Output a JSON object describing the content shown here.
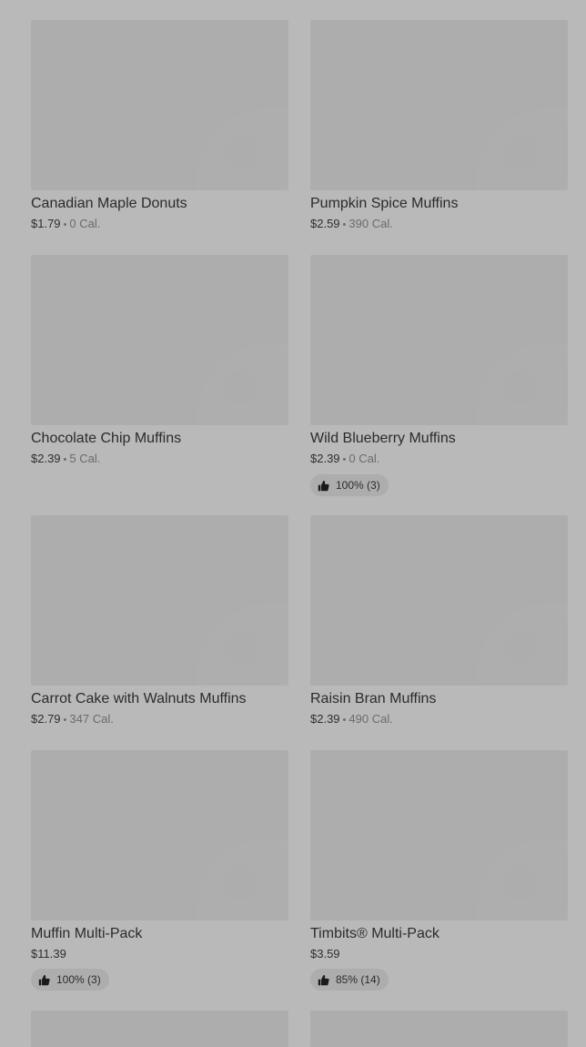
{
  "items": [
    {
      "name": "Canadian Maple Donuts",
      "price": "$1.79",
      "sep": "•",
      "calories": "0 Cal."
    },
    {
      "name": "Pumpkin Spice Muffins",
      "price": "$2.59",
      "sep": "•",
      "calories": "390 Cal."
    },
    {
      "name": "Chocolate Chip Muffins",
      "price": "$2.39",
      "sep": "•",
      "calories": "5 Cal."
    },
    {
      "name": "Wild Blueberry Muffins",
      "price": "$2.39",
      "sep": "•",
      "calories": "0 Cal.",
      "rating": "100% (3)"
    },
    {
      "name": "Carrot Cake with Walnuts Muffins",
      "price": "$2.79",
      "sep": "•",
      "calories": "347 Cal."
    },
    {
      "name": "Raisin Bran Muffins",
      "price": "$2.39",
      "sep": "•",
      "calories": "490 Cal."
    },
    {
      "name": "Muffin Multi-Pack",
      "price": "$11.39",
      "rating": "100% (3)"
    },
    {
      "name": "Timbits® Multi-Pack",
      "price": "$3.59",
      "rating": "85% (14)"
    }
  ],
  "icons": {
    "rating": "thumbs-up-icon"
  },
  "colors": {
    "background": "#b9b9b9",
    "image_placeholder": "#adadad",
    "text": "#2b2b2b",
    "muted": "#6b6b6b"
  }
}
